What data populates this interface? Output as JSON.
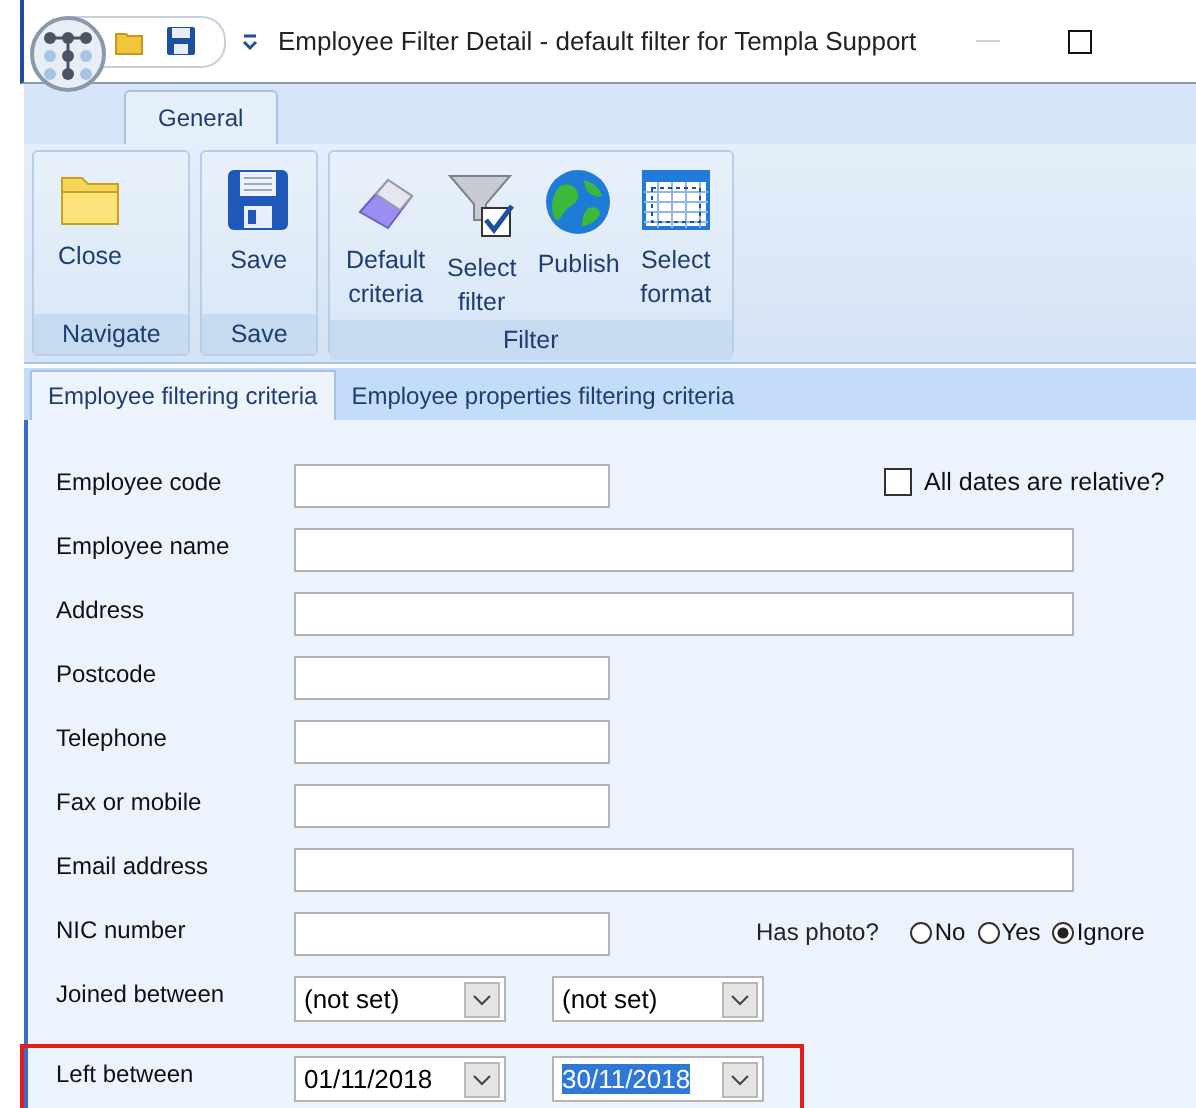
{
  "window": {
    "title": "Employee Filter Detail - default filter for Templa Support"
  },
  "ribbon_tabs": [
    {
      "label": "General",
      "selected": true
    }
  ],
  "ribbon_groups": [
    {
      "label": "Navigate",
      "buttons": [
        {
          "label": "Close"
        }
      ]
    },
    {
      "label": "Save",
      "buttons": [
        {
          "label": "Save"
        }
      ]
    },
    {
      "label": "Filter",
      "buttons": [
        {
          "label": "Default criteria"
        },
        {
          "label": "Select filter"
        },
        {
          "label": "Publish"
        },
        {
          "label": "Select format"
        }
      ]
    }
  ],
  "page_tabs": [
    {
      "label": "Employee filtering criteria",
      "selected": true
    },
    {
      "label": "Employee properties filtering criteria",
      "selected": false
    }
  ],
  "fields": [
    {
      "label": "Employee code",
      "kind": "text",
      "extra": {
        "kind": "checkbox",
        "label": "All dates are relative?",
        "checked": false
      }
    },
    {
      "label": "Employee name",
      "kind": "text"
    },
    {
      "label": "Address",
      "kind": "text"
    },
    {
      "label": "Postcode",
      "kind": "text"
    },
    {
      "label": "Telephone",
      "kind": "text"
    },
    {
      "label": "Fax or mobile",
      "kind": "text"
    },
    {
      "label": "Email address",
      "kind": "text"
    },
    {
      "label": "NIC number",
      "kind": "text",
      "extra": {
        "kind": "radios",
        "label": "Has photo?",
        "options": [
          {
            "label": "No",
            "selected": false
          },
          {
            "label": "Yes",
            "selected": false
          },
          {
            "label": "Ignore",
            "selected": true
          }
        ]
      }
    },
    {
      "label": "Joined between",
      "kind": "range",
      "highlighted": false,
      "from": {
        "value": "(not set)",
        "selected": false
      },
      "to": {
        "value": "(not set)",
        "selected": false
      }
    },
    {
      "label": "Left between",
      "kind": "range",
      "highlighted": true,
      "from": {
        "value": "01/11/2018",
        "selected": false
      },
      "to": {
        "value": "30/11/2018",
        "selected": true
      }
    }
  ]
}
